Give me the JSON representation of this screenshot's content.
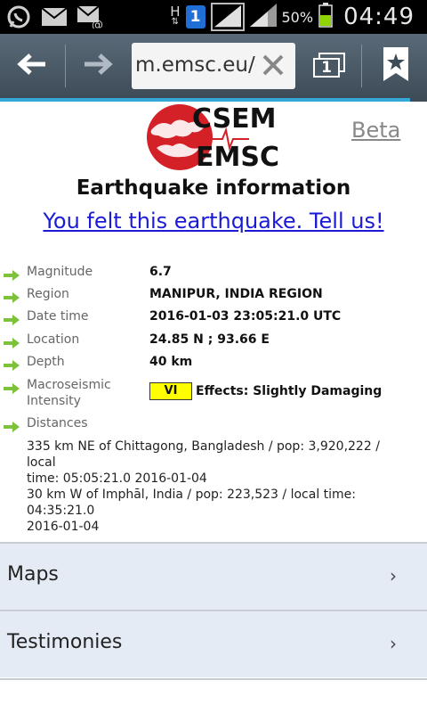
{
  "status_bar": {
    "time": "04:49",
    "battery_percent": "50%",
    "network_type": "H",
    "notification_badge": "1",
    "icons": [
      "whatsapp-icon",
      "email-icon",
      "email-at-icon",
      "network-h-icon",
      "notification-badge-icon",
      "signal-icon",
      "signal-icon-2",
      "battery-icon"
    ]
  },
  "browser": {
    "url": "m.emsc.eu/e",
    "tabs_count": "1",
    "progress_percent": 96
  },
  "page": {
    "logo_text_top": "CSEM",
    "logo_text_bottom": "EMSC",
    "beta_link": "Beta",
    "title": "Earthquake information",
    "felt_link": "You felt this earthquake. Tell us!",
    "fields": {
      "magnitude_label": "Magnitude",
      "magnitude_value": "6.7",
      "region_label": "Region",
      "region_value": "MANIPUR, INDIA REGION",
      "datetime_label": "Date time",
      "datetime_value": "2016-01-03 23:05:21.0 UTC",
      "location_label": "Location",
      "location_value": "24.85 N ; 93.66 E",
      "depth_label": "Depth",
      "depth_value": "40 km",
      "intensity_label_1": "Macroseismic",
      "intensity_label_2": "Intensity",
      "intensity_value": "VI",
      "intensity_effects": "Effects: Slightly Damaging",
      "distances_label": "Distances"
    },
    "distances": [
      {
        "line1": "335 km NE of Chittagong, Bangladesh / pop: 3,920,222 / local",
        "line2": "time: 05:05:21.0 2016-01-04"
      },
      {
        "line1": "30 km W of Imphāl, India / pop: 223,523 / local time: 04:35:21.0",
        "line2": "2016-01-04"
      }
    ],
    "menu": {
      "maps_label": "Maps",
      "testimonies_label": "Testimonies",
      "chevron": "›"
    }
  },
  "colors": {
    "link": "#1b1bd6",
    "accent_progress": "#34a9d8",
    "intensity_badge": "#ffff00",
    "arrow_green": "#7cc23a",
    "logo_red": "#d42027"
  }
}
